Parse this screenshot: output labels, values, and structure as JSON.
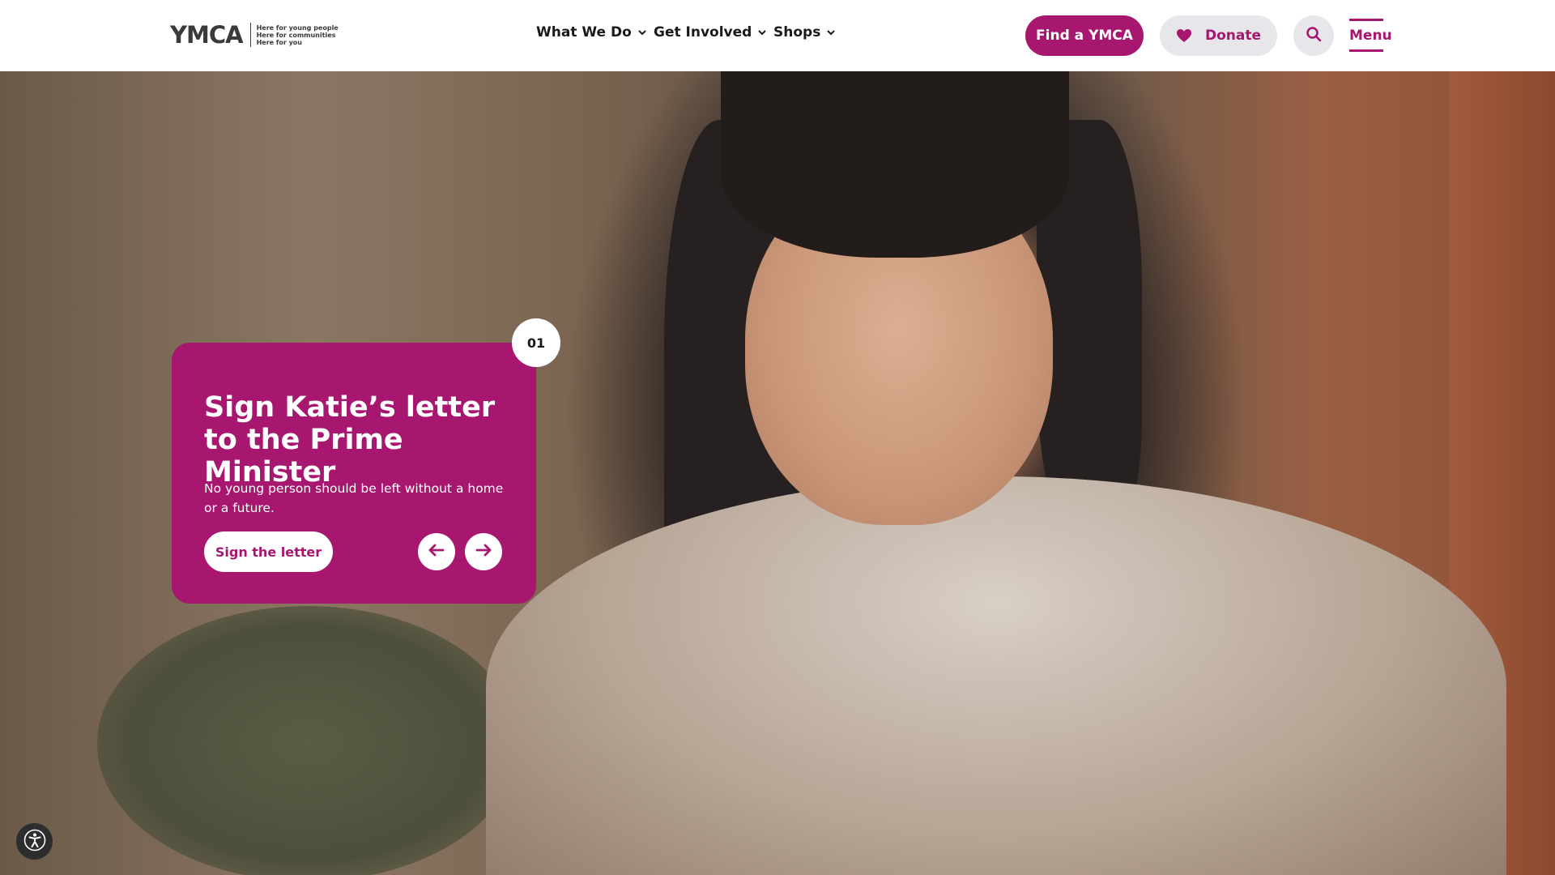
{
  "header": {
    "logo": {
      "mark": "YMCA",
      "tagline": [
        "Here for young people",
        "Here for communities",
        "Here for you"
      ]
    },
    "nav": [
      {
        "label": "What We Do",
        "icon": "chevron-down-icon"
      },
      {
        "label": "Get Involved",
        "icon": "chevron-down-icon"
      },
      {
        "label": "Shops",
        "icon": "chevron-down-icon"
      }
    ],
    "find_label": "Find a YMCA",
    "donate_label": "Donate",
    "donate_icon": "heart-icon",
    "search_icon": "search-icon",
    "menu_label": "Menu"
  },
  "hero": {
    "slide_number": "01",
    "title": "Sign Katie’s letter to the Prime Minister",
    "text": "No young person should be left without a home or a future.",
    "cta_label": "Sign the letter",
    "prev_icon": "arrow-left-icon",
    "next_icon": "arrow-right-icon"
  },
  "accessibility": {
    "icon": "accessibility-icon"
  },
  "colors": {
    "brand": "#a8176f",
    "button_grey": "#e7e6ea",
    "text_dark": "#1a1a1a",
    "white": "#ffffff"
  }
}
